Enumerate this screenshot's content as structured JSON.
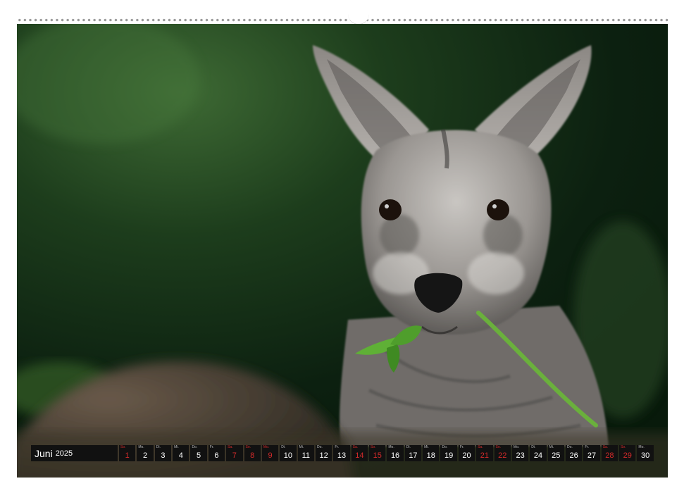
{
  "calendar": {
    "month": "Juni",
    "year": "2025",
    "days": [
      {
        "wd": "So.",
        "num": "1",
        "red": true
      },
      {
        "wd": "Mo.",
        "num": "2",
        "red": false
      },
      {
        "wd": "Di.",
        "num": "3",
        "red": false
      },
      {
        "wd": "Mi.",
        "num": "4",
        "red": false
      },
      {
        "wd": "Do.",
        "num": "5",
        "red": false
      },
      {
        "wd": "Fr.",
        "num": "6",
        "red": false
      },
      {
        "wd": "Sa.",
        "num": "7",
        "red": true
      },
      {
        "wd": "So.",
        "num": "8",
        "red": true
      },
      {
        "wd": "Mo.",
        "num": "9",
        "red": true
      },
      {
        "wd": "Di.",
        "num": "10",
        "red": false
      },
      {
        "wd": "Mi.",
        "num": "11",
        "red": false
      },
      {
        "wd": "Do.",
        "num": "12",
        "red": false
      },
      {
        "wd": "Fr.",
        "num": "13",
        "red": false
      },
      {
        "wd": "Sa.",
        "num": "14",
        "red": true
      },
      {
        "wd": "So.",
        "num": "15",
        "red": true
      },
      {
        "wd": "Mo.",
        "num": "16",
        "red": false
      },
      {
        "wd": "Di.",
        "num": "17",
        "red": false
      },
      {
        "wd": "Mi.",
        "num": "18",
        "red": false
      },
      {
        "wd": "Do.",
        "num": "19",
        "red": false
      },
      {
        "wd": "Fr.",
        "num": "20",
        "red": false
      },
      {
        "wd": "Sa.",
        "num": "21",
        "red": true
      },
      {
        "wd": "So.",
        "num": "22",
        "red": true
      },
      {
        "wd": "Mo.",
        "num": "23",
        "red": false
      },
      {
        "wd": "Di.",
        "num": "24",
        "red": false
      },
      {
        "wd": "Mi.",
        "num": "25",
        "red": false
      },
      {
        "wd": "Do.",
        "num": "26",
        "red": false
      },
      {
        "wd": "Fr.",
        "num": "27",
        "red": false
      },
      {
        "wd": "Sa.",
        "num": "28",
        "red": true
      },
      {
        "wd": "So.",
        "num": "29",
        "red": true
      },
      {
        "wd": "Mo.",
        "num": "30",
        "red": false
      }
    ]
  },
  "colors": {
    "bar_bg": "#111111",
    "weekend": "#d22a2a",
    "background_green": "#0f2813"
  },
  "photo": {
    "subject_icon": "kangaroo-photo"
  }
}
